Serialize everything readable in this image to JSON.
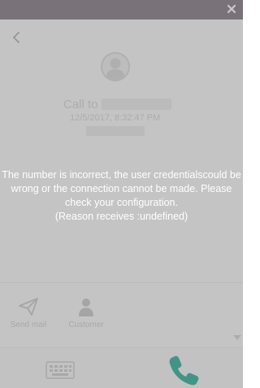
{
  "call": {
    "call_to_label": "Call to",
    "timestamp": "12/5/2017, 8:32:47 PM"
  },
  "actions": [
    {
      "label": "Send mail",
      "icon": "paper-plane-icon"
    },
    {
      "label": "Customer",
      "icon": "person-icon"
    }
  ],
  "error": {
    "lines": [
      "The number is incorrect, the user credentialscould be",
      "wrong or the connection cannot be made. Please",
      "check your configuration.",
      "(Reason receives :undefined)"
    ]
  },
  "colors": {
    "titlebar": "#7c6f7a",
    "phone_accent": "#1fa98f",
    "overlay": "rgba(120,120,120,0.40)"
  }
}
